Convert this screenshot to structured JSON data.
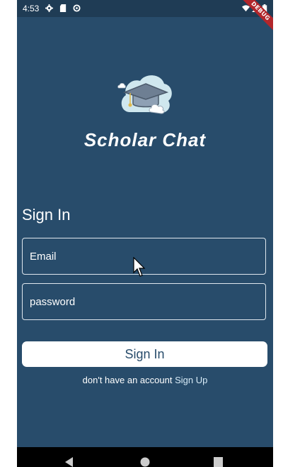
{
  "status_bar": {
    "time": "4:53",
    "icons": [
      "gear-icon",
      "sd-card-icon",
      "data-saver-icon",
      "wifi-icon",
      "signal-icon",
      "battery-icon"
    ]
  },
  "debug_banner": "DEBUG",
  "app": {
    "title": "Scholar Chat",
    "logo": "graduation-cap-cloud-icon"
  },
  "form": {
    "heading": "Sign In",
    "email_placeholder": "Email",
    "password_placeholder": "password",
    "submit_label": "Sign In"
  },
  "signup": {
    "prompt": "don't have an account",
    "link_label": "Sign Up"
  },
  "nav_bar": {
    "icons": [
      "back-icon",
      "home-icon",
      "recents-icon"
    ]
  },
  "colors": {
    "background": "#284c6b",
    "status_bar": "#1f3c55",
    "button_background": "#ffffff",
    "button_text": "#284c6b",
    "debug_banner": "#b2262b"
  }
}
